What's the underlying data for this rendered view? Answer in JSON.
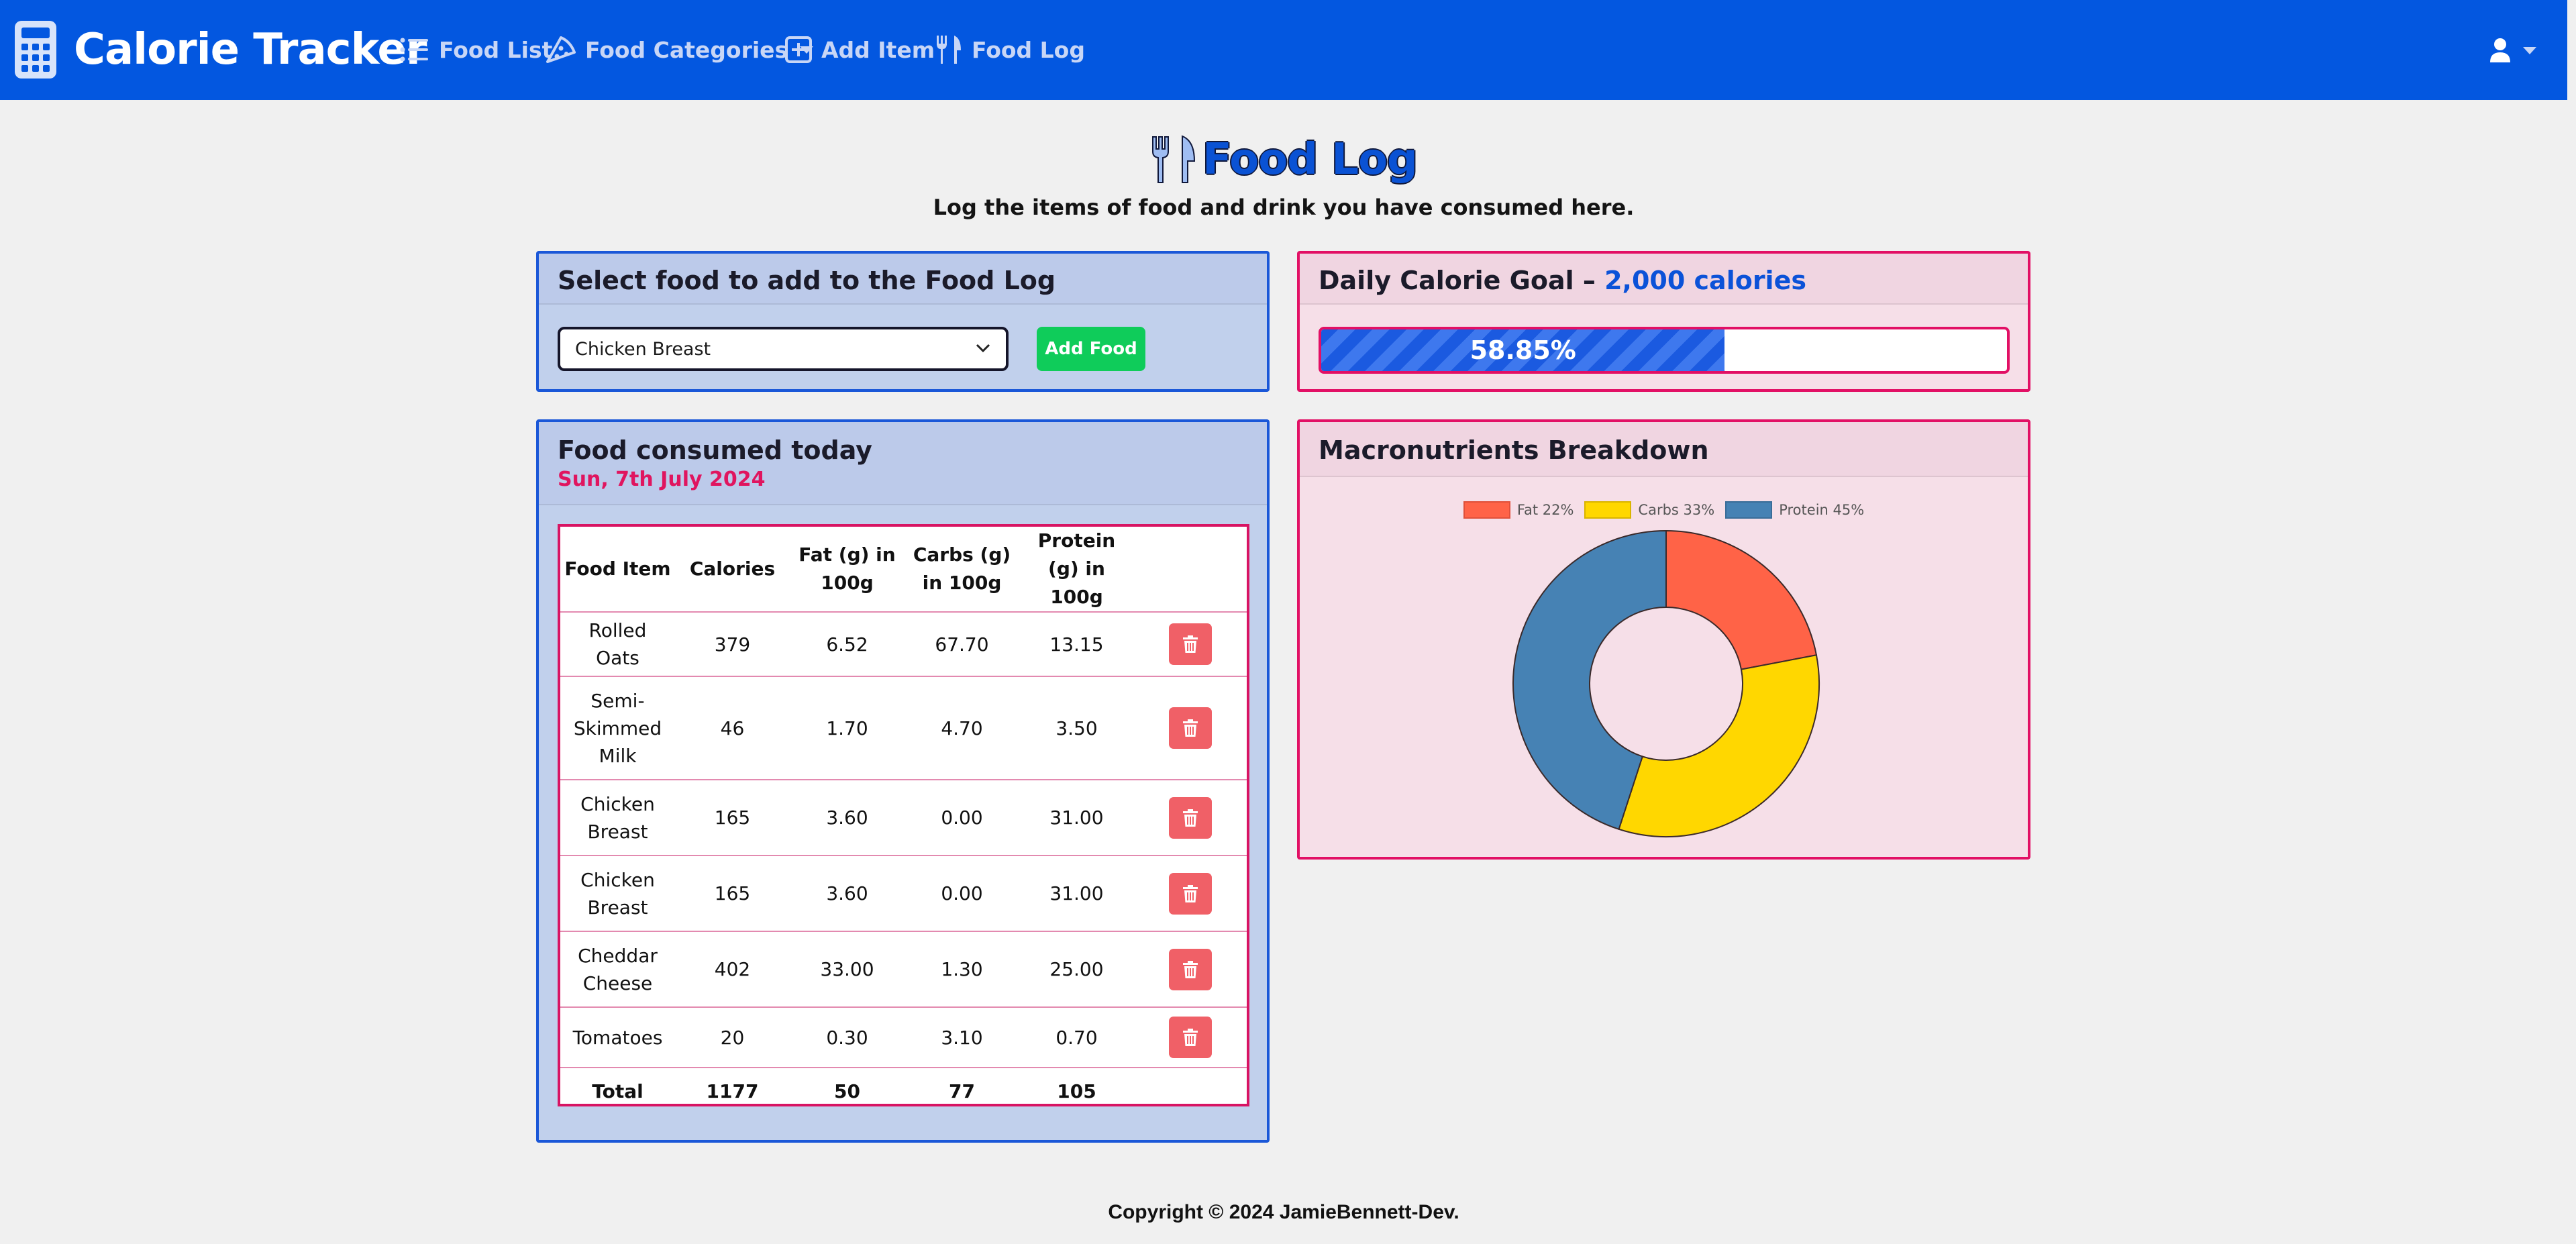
{
  "nav": {
    "brand": "Calorie Tracker",
    "links": [
      {
        "label": "Food List"
      },
      {
        "label": "Food Categories"
      },
      {
        "label": "Add Item"
      },
      {
        "label": "Food Log"
      }
    ]
  },
  "page": {
    "title": "Food Log",
    "subtitle": "Log the items of food and drink you have consumed here."
  },
  "select_card": {
    "title": "Select food to add to the Food Log",
    "selected": "Chicken Breast",
    "button": "Add Food"
  },
  "goal_card": {
    "title": "Daily Calorie Goal – ",
    "goal": "2,000 calories",
    "progress_label": "58.85%",
    "progress_fraction": 0.5885
  },
  "consumed_card": {
    "title": "Food consumed today",
    "date": "Sun, 7th July 2024",
    "columns": [
      "Food Item",
      "Calories",
      "Fat (g) in 100g",
      "Carbs (g) in 100g",
      "Protein (g) in 100g"
    ],
    "rows": [
      {
        "item": "Rolled Oats",
        "calories": "379",
        "fat": "6.52",
        "carbs": "67.70",
        "protein": "13.15"
      },
      {
        "item": "Semi-Skimmed Milk",
        "calories": "46",
        "fat": "1.70",
        "carbs": "4.70",
        "protein": "3.50"
      },
      {
        "item": "Chicken Breast",
        "calories": "165",
        "fat": "3.60",
        "carbs": "0.00",
        "protein": "31.00"
      },
      {
        "item": "Chicken Breast",
        "calories": "165",
        "fat": "3.60",
        "carbs": "0.00",
        "protein": "31.00"
      },
      {
        "item": "Cheddar Cheese",
        "calories": "402",
        "fat": "33.00",
        "carbs": "1.30",
        "protein": "25.00"
      },
      {
        "item": "Tomatoes",
        "calories": "20",
        "fat": "0.30",
        "carbs": "3.10",
        "protein": "0.70"
      }
    ],
    "total": {
      "label": "Total",
      "calories": "1177",
      "fat": "50",
      "carbs": "77",
      "protein": "105"
    }
  },
  "macro_card": {
    "title": "Macronutrients Breakdown"
  },
  "chart_data": {
    "type": "pie",
    "labels": [
      "Fat 22%",
      "Carbs 33%",
      "Protein 45%"
    ],
    "values": [
      22,
      33,
      45
    ],
    "colors": [
      "#ff6347",
      "#ffd700",
      "#4682b4"
    ],
    "legend": "top"
  },
  "footer": "Copyright © 2024 JamieBennett-Dev."
}
